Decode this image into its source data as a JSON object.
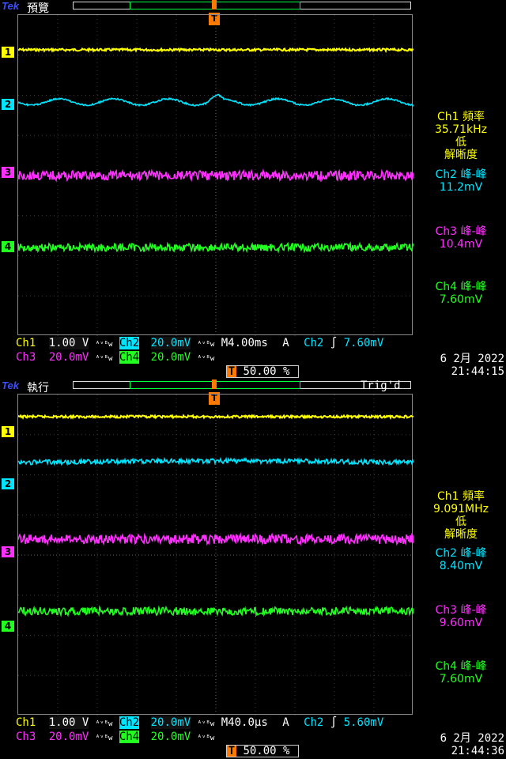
{
  "colors": {
    "ch1": "#ffff00",
    "ch2": "#00e5ff",
    "ch3": "#ff30ff",
    "ch4": "#20ff20",
    "trigger": "#ff7a00",
    "brand": "#3a4fff"
  },
  "panels": [
    {
      "brand": "Tek",
      "mode": "預覽",
      "status": "",
      "markers": [
        "1",
        "2",
        "3",
        "4"
      ],
      "measurements": {
        "ch1_label": "Ch1 頻率",
        "ch1_value": "35.71kHz",
        "ch1_note1": "低",
        "ch1_note2": "解晰度",
        "ch2_label": "Ch2 峰-峰",
        "ch2_value": "11.2mV",
        "ch3_label": "Ch3 峰-峰",
        "ch3_value": "10.4mV",
        "ch4_label": "Ch4 峰-峰",
        "ch4_value": "7.60mV"
      },
      "bottom": {
        "ch1": "Ch1",
        "ch1_scale": "1.00 V",
        "ch2": "Ch2",
        "ch2_scale": "20.0mV",
        "ch3": "Ch3",
        "ch3_scale": "20.0mV",
        "ch4": "Ch4",
        "ch4_scale": "20.0mV",
        "bw": "ᴬᵛᴮw",
        "timebase": "M4.00ms",
        "trig_mode": "A",
        "trig_src": "Ch2",
        "trig_slope": "∫",
        "trig_level": "7.60mV",
        "trig_pos": "50.00 %"
      },
      "date": "6 2月  2022",
      "time": "21:44:15"
    },
    {
      "brand": "Tek",
      "mode": "執行",
      "status": "Trig'd",
      "markers": [
        "1",
        "2",
        "3",
        "4"
      ],
      "measurements": {
        "ch1_label": "Ch1 頻率",
        "ch1_value": "9.091MHz",
        "ch1_note1": "低",
        "ch1_note2": "解晰度",
        "ch2_label": "Ch2 峰-峰",
        "ch2_value": "8.40mV",
        "ch3_label": "Ch3 峰-峰",
        "ch3_value": "9.60mV",
        "ch4_label": "Ch4 峰-峰",
        "ch4_value": "7.60mV"
      },
      "bottom": {
        "ch1": "Ch1",
        "ch1_scale": "1.00 V",
        "ch2": "Ch2",
        "ch2_scale": "20.0mV",
        "ch3": "Ch3",
        "ch3_scale": "20.0mV",
        "ch4": "Ch4",
        "ch4_scale": "20.0mV",
        "bw": "ᴬᵛᴮw",
        "timebase": "M40.0µs",
        "trig_mode": "A",
        "trig_src": "Ch2",
        "trig_slope": "∫",
        "trig_level": "5.60mV",
        "trig_pos": "50.00 %"
      },
      "date": "6 2月  2022",
      "time": "21:44:36"
    }
  ]
}
